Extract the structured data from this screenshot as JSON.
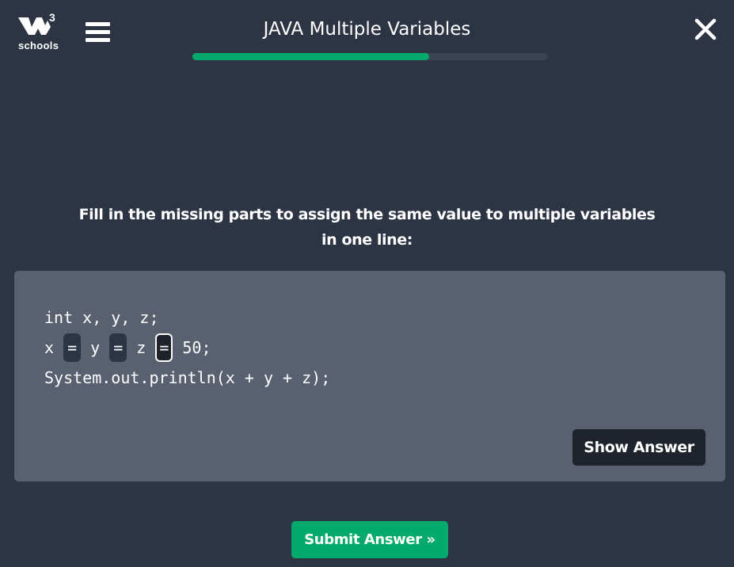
{
  "logo": {
    "superscript": "3",
    "wordmark": "schools"
  },
  "header": {
    "title": "JAVA Multiple Variables",
    "progress_percent": 66.5,
    "menu_icon": "hamburger-icon",
    "close_icon": "close-icon"
  },
  "question": "Fill in the missing parts to assign the same value to multiple variables in one line:",
  "code": {
    "line1": "int x, y, z;",
    "line2_parts": [
      "x ",
      " y ",
      " z ",
      " 50;"
    ],
    "blanks": [
      "=",
      "=",
      "="
    ],
    "line3": "System.out.println(x + y + z);"
  },
  "buttons": {
    "show_answer": "Show Answer",
    "submit": "Submit Answer »"
  },
  "colors": {
    "background": "#2d3545",
    "accent": "#04aa6d",
    "codebox": "#596070"
  }
}
